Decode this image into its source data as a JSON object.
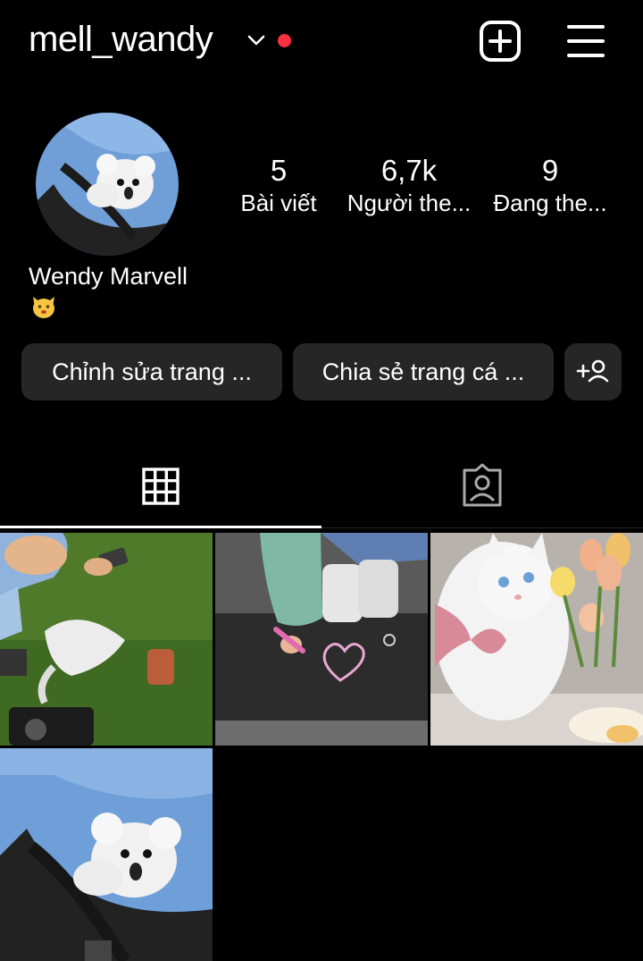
{
  "header": {
    "username": "mell_wandy",
    "icons": {
      "dropdown": "chevron-down-icon",
      "notify": "red-dot",
      "create": "plus-square-icon",
      "menu": "hamburger-menu-icon"
    },
    "notify_color": "#ff3040"
  },
  "profile": {
    "display_name": "Wendy Marvell",
    "bio_emoji": "cat-face-emoji",
    "stats": [
      {
        "value": "5",
        "label": "Bài viết"
      },
      {
        "value": "6,7k",
        "label": "Người the..."
      },
      {
        "value": "9",
        "label": "Đang the..."
      }
    ]
  },
  "actions": {
    "edit_profile": "Chỉnh sửa trang ...",
    "share_profile": "Chia sẻ trang cá ...",
    "discover_people_icon": "add-person-icon"
  },
  "tabs": [
    {
      "name": "posts-grid",
      "icon": "grid-icon",
      "active": true
    },
    {
      "name": "tagged",
      "icon": "tagged-person-icon",
      "active": false
    }
  ],
  "posts": [
    {
      "name": "post-picnic-grass"
    },
    {
      "name": "post-chalk-heart"
    },
    {
      "name": "post-white-kitten"
    },
    {
      "name": "post-plush-bear"
    }
  ],
  "colors": {
    "background": "#000000",
    "button": "#262626",
    "text": "#ffffff"
  }
}
